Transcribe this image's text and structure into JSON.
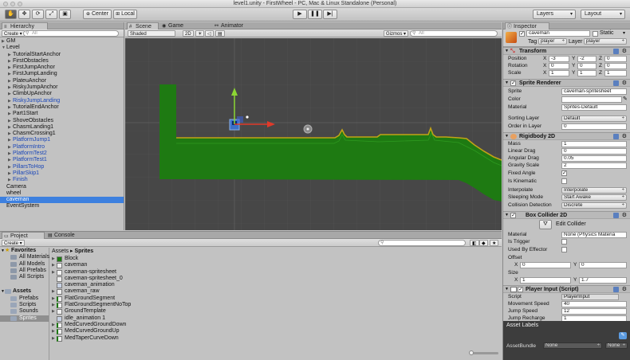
{
  "window": {
    "title": "level1.unity - FirstWheel - PC, Mac & Linux Standalone (Personal)"
  },
  "toolbar": {
    "pivot_label": "Center",
    "space_label": "Local",
    "layers_label": "Layers",
    "layout_label": "Layout"
  },
  "hierarchy": {
    "tab": "Hierarchy",
    "create": "Create",
    "search_placeholder": "All",
    "items": [
      {
        "label": "GM",
        "depth": 0,
        "arrow": "▶",
        "color": "normal"
      },
      {
        "label": "Level",
        "depth": 0,
        "arrow": "▼",
        "color": "normal"
      },
      {
        "label": "TutorialStartAnchor",
        "depth": 1,
        "arrow": "▶",
        "color": "normal"
      },
      {
        "label": "FirstObstacles",
        "depth": 1,
        "arrow": "▶",
        "color": "normal"
      },
      {
        "label": "FirstJumpAnchor",
        "depth": 1,
        "arrow": "▶",
        "color": "normal"
      },
      {
        "label": "FirstJumpLanding",
        "depth": 1,
        "arrow": "▶",
        "color": "normal"
      },
      {
        "label": "PlateuAnchor",
        "depth": 1,
        "arrow": "▶",
        "color": "normal"
      },
      {
        "label": "RiskyJumpAnchor",
        "depth": 1,
        "arrow": "▶",
        "color": "normal"
      },
      {
        "label": "ClimbUpAnchor",
        "depth": 1,
        "arrow": "▶",
        "color": "normal"
      },
      {
        "label": "RiskyJumpLanding",
        "depth": 1,
        "arrow": "▶",
        "color": "blue"
      },
      {
        "label": "TutorialEndAnchor",
        "depth": 1,
        "arrow": "▶",
        "color": "normal"
      },
      {
        "label": "Part1Start",
        "depth": 1,
        "arrow": "▶",
        "color": "normal"
      },
      {
        "label": "ShoveObstacles",
        "depth": 1,
        "arrow": "▶",
        "color": "normal"
      },
      {
        "label": "ChasmLanding1",
        "depth": 1,
        "arrow": "▶",
        "color": "normal"
      },
      {
        "label": "ChasmCrossing1",
        "depth": 1,
        "arrow": "▶",
        "color": "normal"
      },
      {
        "label": "PlatformJump1",
        "depth": 1,
        "arrow": "▶",
        "color": "blue"
      },
      {
        "label": "PlatformIntro",
        "depth": 1,
        "arrow": "▶",
        "color": "blue"
      },
      {
        "label": "PlatformTest2",
        "depth": 1,
        "arrow": "▶",
        "color": "blue"
      },
      {
        "label": "PlatformTest1",
        "depth": 1,
        "arrow": "▶",
        "color": "blue"
      },
      {
        "label": "PillarsToHop",
        "depth": 1,
        "arrow": "▶",
        "color": "blue"
      },
      {
        "label": "PillarSkip1",
        "depth": 1,
        "arrow": "▶",
        "color": "blue"
      },
      {
        "label": "Finish",
        "depth": 1,
        "arrow": "▶",
        "color": "blue"
      },
      {
        "label": "Camera",
        "depth": 0,
        "arrow": "",
        "color": "normal"
      },
      {
        "label": "wheel",
        "depth": 0,
        "arrow": "",
        "color": "normal"
      },
      {
        "label": "caveman",
        "depth": 0,
        "arrow": "",
        "color": "selected"
      },
      {
        "label": "EventSystem",
        "depth": 0,
        "arrow": "",
        "color": "normal"
      }
    ]
  },
  "scene": {
    "tabs": [
      "Scene",
      "Game",
      "Animator"
    ],
    "shading": "Shaded",
    "mode_2d": "2D",
    "gizmos": "Gizmos",
    "search_placeholder": "All"
  },
  "inspector": {
    "tab": "Inspector",
    "object_name": "caveman",
    "static_label": "Static",
    "tag_label": "Tag",
    "tag_value": "player",
    "layer_label": "Layer",
    "layer_value": "player",
    "transform": {
      "title": "Transform",
      "position": {
        "label": "Position",
        "x": "-3",
        "y": "-2",
        "z": "0"
      },
      "rotation": {
        "label": "Rotation",
        "x": "0",
        "y": "0",
        "z": "0"
      },
      "scale": {
        "label": "Scale",
        "x": "1",
        "y": "1",
        "z": "1"
      }
    },
    "sprite_renderer": {
      "title": "Sprite Renderer",
      "sprite_label": "Sprite",
      "sprite_value": "caveman-spritesheet",
      "color_label": "Color",
      "material_label": "Material",
      "material_value": "Sprites-Default",
      "sorting_layer_label": "Sorting Layer",
      "sorting_layer_value": "Default",
      "order_label": "Order in Layer",
      "order_value": "0"
    },
    "rigidbody": {
      "title": "Rigidbody 2D",
      "mass_label": "Mass",
      "mass_value": "1",
      "linear_drag_label": "Linear Drag",
      "linear_drag_value": "0",
      "angular_drag_label": "Angular Drag",
      "angular_drag_value": "0.05",
      "gravity_label": "Gravity Scale",
      "gravity_value": "2",
      "fixed_angle_label": "Fixed Angle",
      "kinematic_label": "Is Kinematic",
      "interpolate_label": "Interpolate",
      "interpolate_value": "Interpolate",
      "sleeping_label": "Sleeping Mode",
      "sleeping_value": "Start Awake",
      "collision_label": "Collision Detection",
      "collision_value": "Discrete"
    },
    "box_collider": {
      "title": "Box Collider 2D",
      "edit_label": "Edit Collider",
      "material_label": "Material",
      "material_value": "None (Physics Materia",
      "trigger_label": "Is Trigger",
      "effector_label": "Used By Effector",
      "offset_label": "Offset",
      "offset_x": "0",
      "offset_y": "0",
      "size_label": "Size",
      "size_x": "1",
      "size_y": "1.7"
    },
    "player_input": {
      "title": "Player Input (Script)",
      "script_label": "Script",
      "script_value": "PlayerInput",
      "speed_label": "Movement Speed",
      "speed_value": "40",
      "jump_label": "Jump Speed",
      "jump_value": "12",
      "recharge_label": "Jump Recharge",
      "recharge_value": "1"
    },
    "asset_labels": "Asset Labels",
    "asset_bundle_label": "AssetBundle",
    "asset_bundle_value": "None",
    "asset_bundle_value2": "None"
  },
  "project": {
    "tabs": [
      "Project",
      "Console"
    ],
    "create": "Create",
    "favorites_label": "Favorites",
    "favorites": [
      "All Materials",
      "All Models",
      "All Prefabs",
      "All Scripts"
    ],
    "assets_label": "Assets",
    "folders": [
      "Prefabs",
      "Scripts",
      "Sounds",
      "Sprites"
    ],
    "breadcrumb": [
      "Assets",
      "Sprites"
    ],
    "files": [
      {
        "label": "Block",
        "arrow": "▶",
        "kind": "green"
      },
      {
        "label": "caveman",
        "arrow": "▶",
        "kind": "sprite"
      },
      {
        "label": "caveman-spritesheet",
        "arrow": "▶",
        "kind": "sheet"
      },
      {
        "label": "caveman-spritesheet_0",
        "arrow": "",
        "kind": "sprite"
      },
      {
        "label": "caveman_animation",
        "arrow": "",
        "kind": "anim"
      },
      {
        "label": "caveman_raw",
        "arrow": "▶",
        "kind": "sprite"
      },
      {
        "label": "FlatGroundSegment",
        "arrow": "▶",
        "kind": "bar"
      },
      {
        "label": "FlatGroundSegmentNoTop",
        "arrow": "▶",
        "kind": "bar"
      },
      {
        "label": "GroundTemplate",
        "arrow": "▶",
        "kind": "sprite"
      },
      {
        "label": "idle_animation 1",
        "arrow": "",
        "kind": "anim"
      },
      {
        "label": "MedCurvedGroundDown",
        "arrow": "▶",
        "kind": "bar"
      },
      {
        "label": "MedCurvedGroundUp",
        "arrow": "▶",
        "kind": "bar"
      },
      {
        "label": "MedTaperCurveDown",
        "arrow": "▶",
        "kind": "bar"
      }
    ]
  }
}
